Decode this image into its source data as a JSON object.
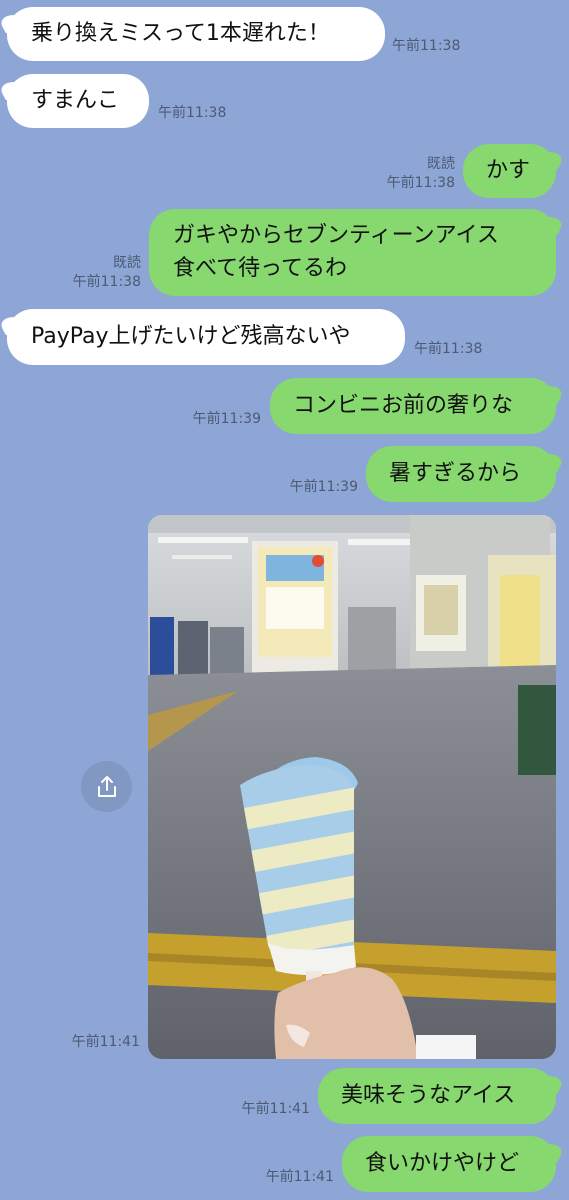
{
  "messages": [
    {
      "id": "m1",
      "side": "in",
      "text": "乗り換えミスって1本遅れた！",
      "time": "午前11:38"
    },
    {
      "id": "m2",
      "side": "in",
      "text": "すまんこ",
      "time": "午前11:38"
    },
    {
      "id": "m3",
      "side": "out",
      "text": "かす",
      "read": "既読",
      "time": "午前11:38"
    },
    {
      "id": "m4",
      "side": "out",
      "lines": [
        "ガキやからセブンティーンアイス",
        "食べて待ってるわ"
      ],
      "read": "既読",
      "time": "午前11:38"
    },
    {
      "id": "m5",
      "side": "in",
      "text": "PayPay上げたいけど残高ないや",
      "time": "午前11:38"
    },
    {
      "id": "m6",
      "side": "out",
      "text": "コンビニお前の奢りな",
      "time": "午前11:39"
    },
    {
      "id": "m7",
      "side": "out",
      "text": "暑すぎるから",
      "time": "午前11:39"
    },
    {
      "id": "m8",
      "side": "out",
      "type": "photo",
      "time": "午前11:41"
    },
    {
      "id": "m9",
      "side": "out",
      "text": "美味そうなアイス",
      "time": "午前11:41"
    },
    {
      "id": "m10",
      "side": "out",
      "text": "食いかけやけど",
      "time": "午前11:41"
    }
  ],
  "icons": {
    "share": "share-icon"
  },
  "colors": {
    "background": "#8da6d6",
    "bubble_in": "#ffffff",
    "bubble_out": "#86d86f",
    "meta_text": "#4d5a73"
  }
}
